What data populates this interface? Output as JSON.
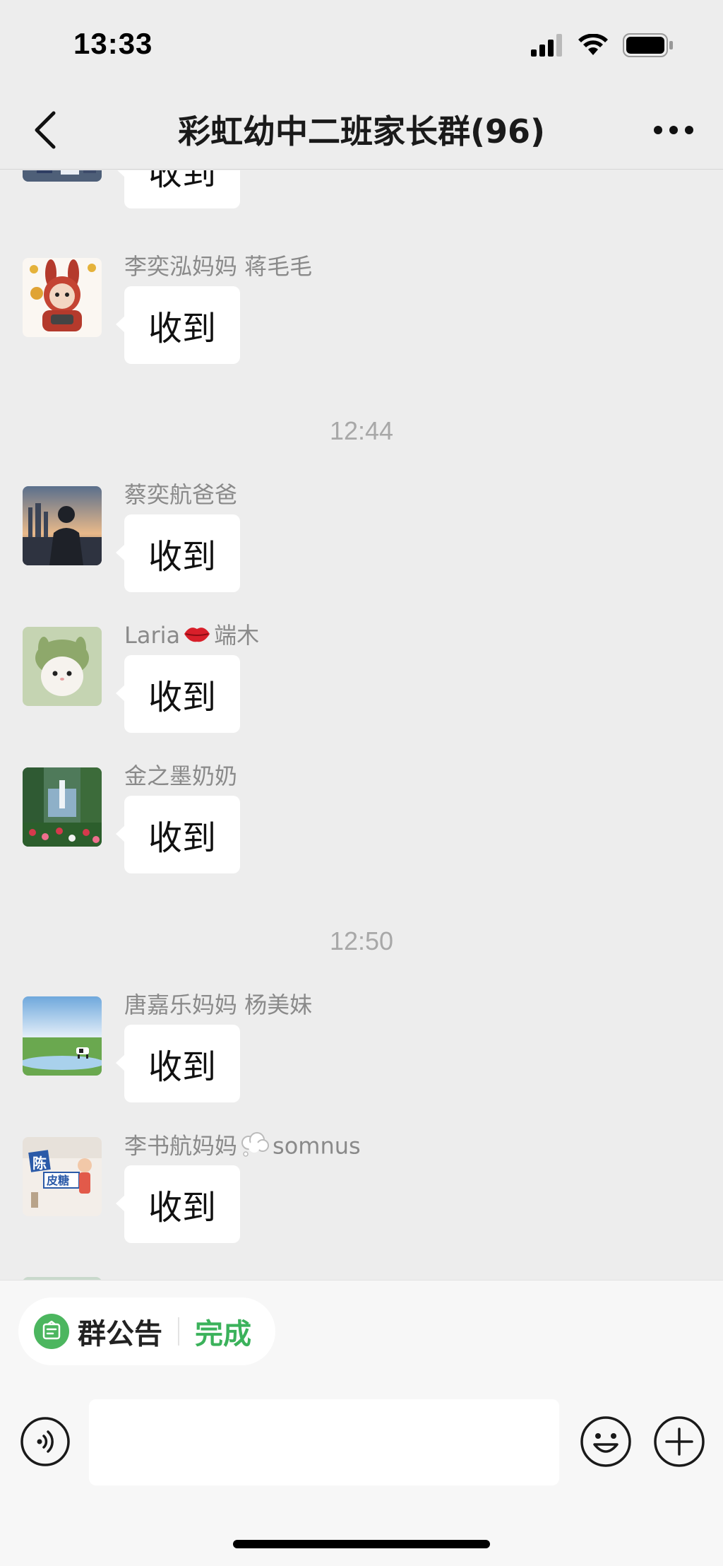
{
  "status_bar": {
    "time": "13:33"
  },
  "header": {
    "title": "彩虹幼中二班家长群(96)"
  },
  "messages": [
    {
      "sender": "",
      "text": "收到",
      "avatar": "group-photo-avatar"
    },
    {
      "sender": "李奕泓妈妈  蒋毛毛",
      "text": "收到",
      "avatar": "cartoon-rabbit-avatar"
    },
    {
      "sender": "蔡奕航爸爸",
      "text": "收到",
      "avatar": "sunset-silhouette-avatar"
    },
    {
      "sender_prefix": "Laria",
      "sender_suffix": "端木",
      "sender_emoji": "lips-emoji",
      "text": "收到",
      "avatar": "bunny-hat-avatar"
    },
    {
      "sender": "金之墨奶奶",
      "text": "收到",
      "avatar": "fountain-garden-avatar"
    },
    {
      "sender": "唐嘉乐妈妈 杨美妹",
      "text": "收到",
      "avatar": "meadow-cows-avatar"
    },
    {
      "sender_prefix": "李书航妈妈",
      "sender_suffix": "somnus",
      "sender_emoji": "thought-bubble-emoji",
      "text": "收到",
      "avatar": "name-sign-avatar"
    }
  ],
  "avatar_text": {
    "name_sign_top": "陈",
    "name_sign_bottom": "皮糖"
  },
  "time_dividers": [
    "12:44",
    "12:50"
  ],
  "announcement": {
    "label": "群公告",
    "done_label": "完成"
  },
  "input": {
    "value": ""
  },
  "colors": {
    "background": "#ededed",
    "bubble": "#ffffff",
    "accent_green": "#3bb25b",
    "name_gray": "#8a8a8a"
  }
}
